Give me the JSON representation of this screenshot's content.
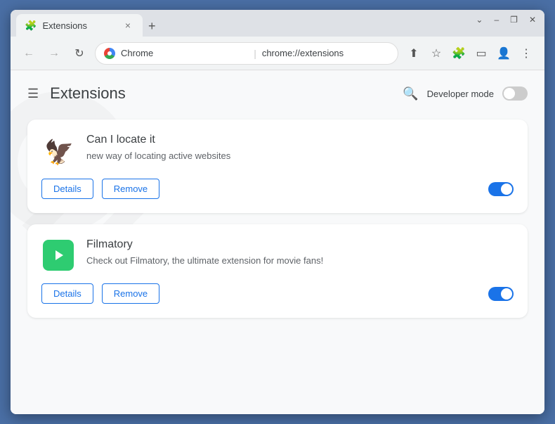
{
  "browser": {
    "tab_title": "Extensions",
    "tab_close_char": "×",
    "new_tab_char": "+",
    "url_site": "Chrome",
    "url_path": "chrome://extensions",
    "nav_back": "←",
    "nav_forward": "→",
    "nav_refresh": "↻",
    "window_minimize": "—",
    "window_maximize": "□",
    "window_close": "✕",
    "window_minimize_char": "–",
    "window_restore_char": "❐",
    "window_close_char": "✕",
    "chevron_down": "⌄"
  },
  "extensions_page": {
    "hamburger": "☰",
    "title": "Extensions",
    "search_icon": "🔍",
    "developer_mode_label": "Developer mode",
    "developer_mode_on": false
  },
  "extensions": [
    {
      "id": "can-i-locate-it",
      "name": "Can I locate it",
      "description": "new way of locating active websites",
      "enabled": true,
      "details_label": "Details",
      "remove_label": "Remove"
    },
    {
      "id": "filmatory",
      "name": "Filmatory",
      "description": "Check out Filmatory, the ultimate extension for movie fans!",
      "enabled": true,
      "details_label": "Details",
      "remove_label": "Remove"
    }
  ]
}
